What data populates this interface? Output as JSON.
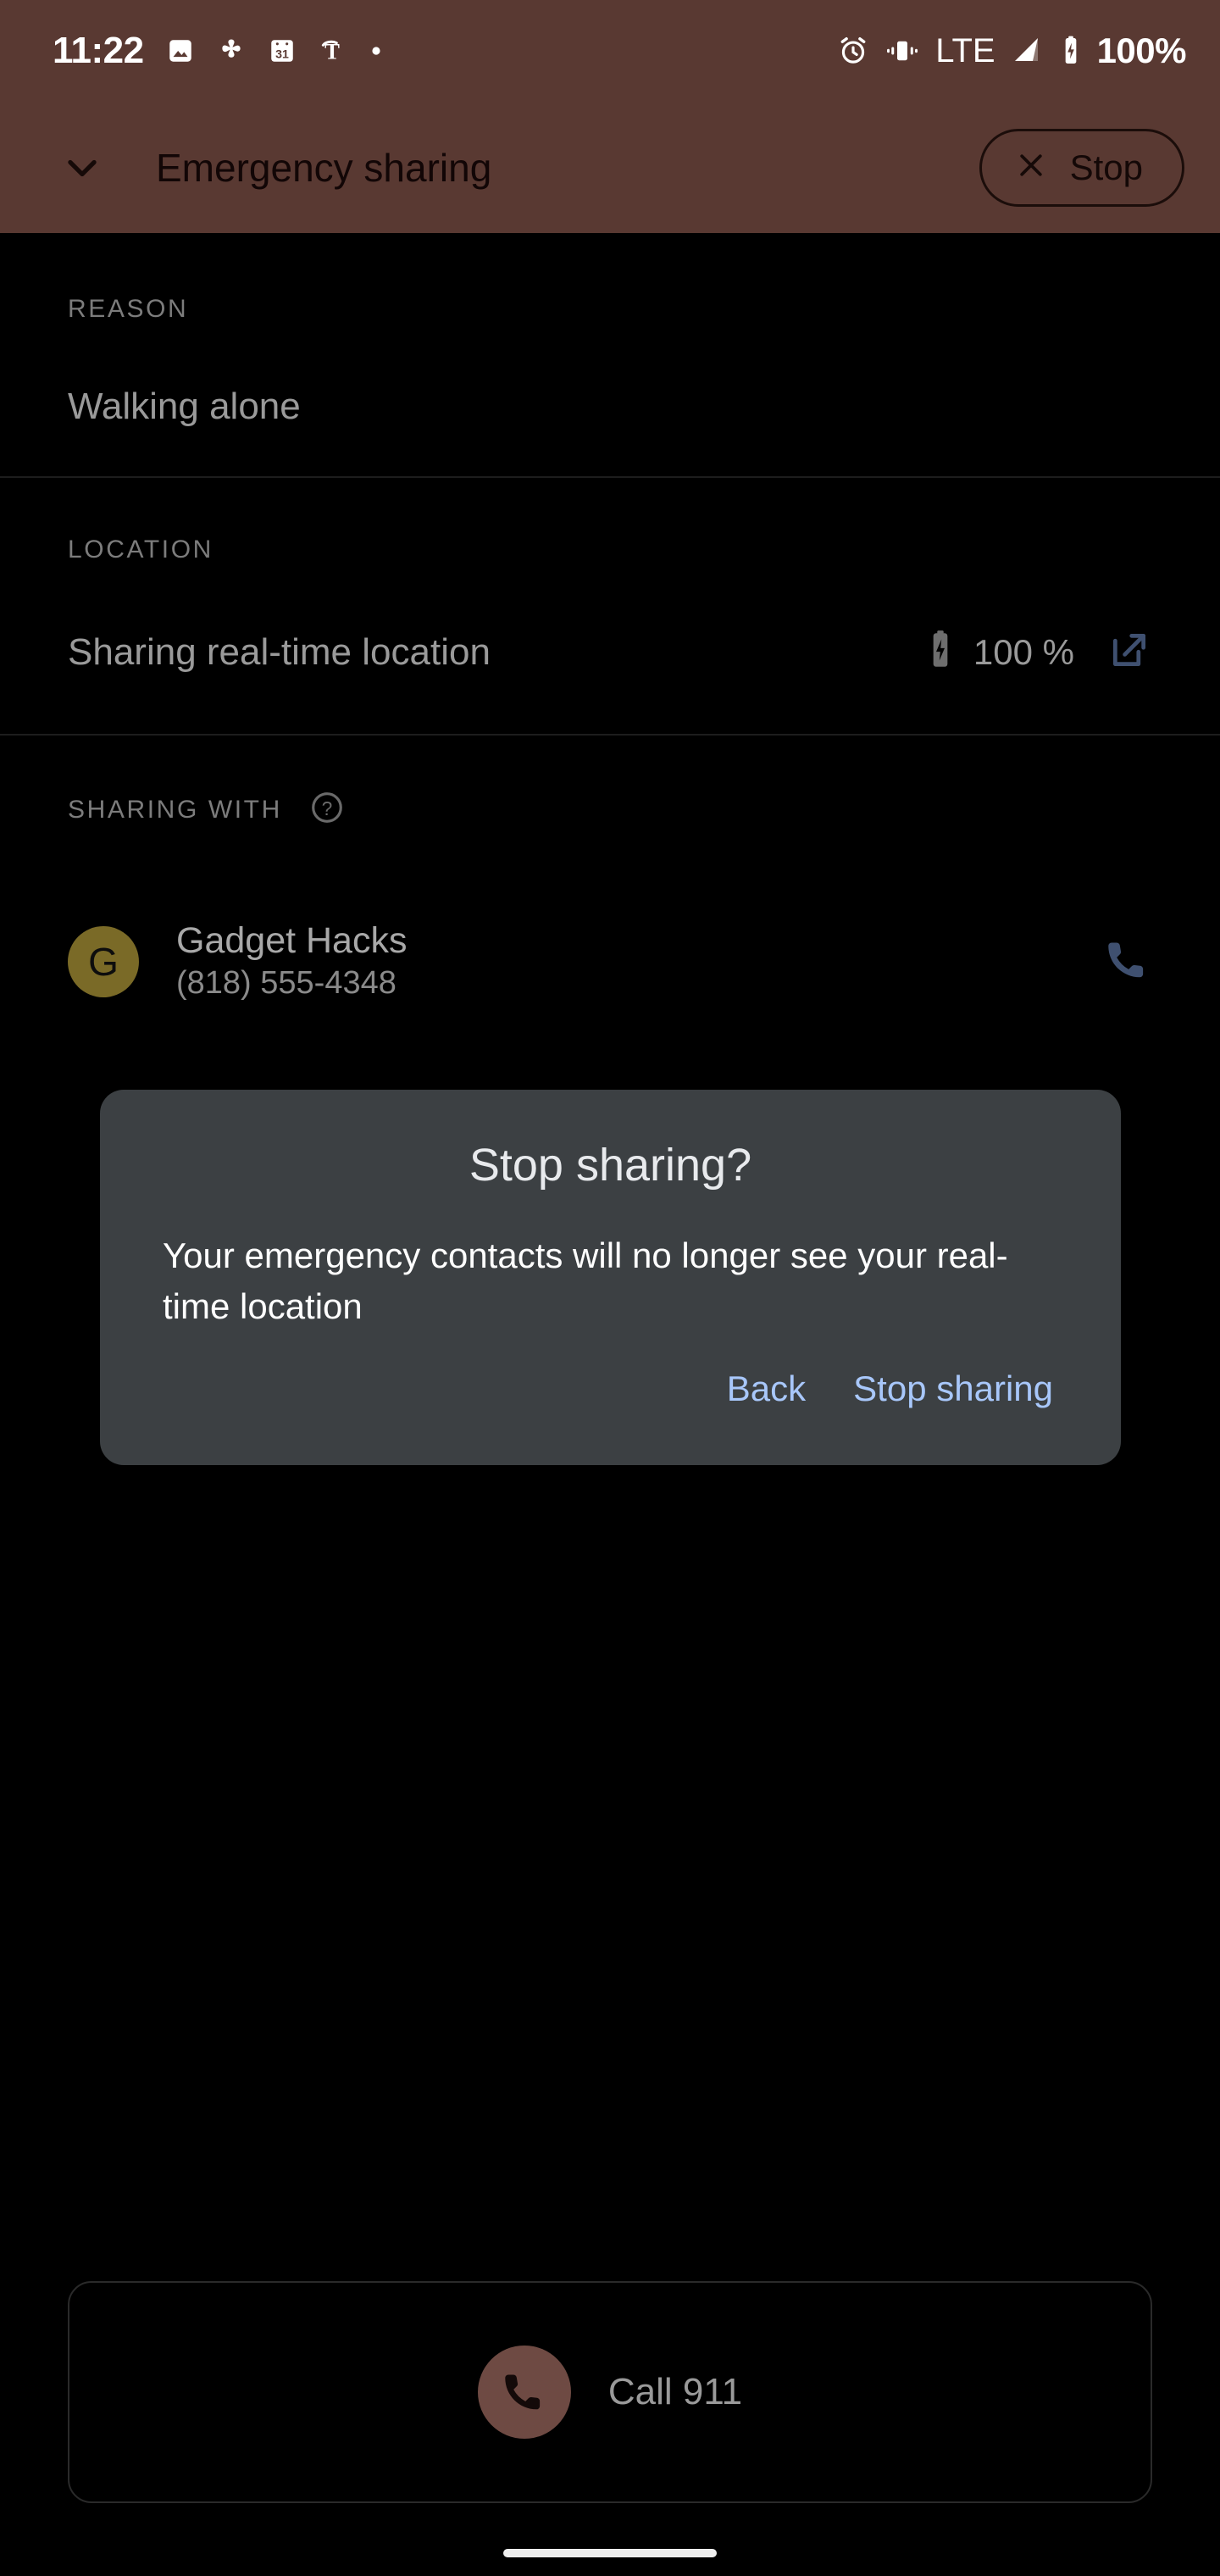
{
  "status_bar": {
    "time": "11:22",
    "battery_percent": "100%",
    "left_icons": [
      "photos-icon",
      "asterisk-icon",
      "calendar-31-icon",
      "nytimes-icon",
      "dot-icon"
    ],
    "right_icons": [
      "alarm-icon",
      "vibrate-icon",
      "lte-label",
      "signal-bars-icon",
      "battery-charging-icon"
    ],
    "network_label": "LTE",
    "background_color": "#593932"
  },
  "header": {
    "title": "Emergency sharing",
    "collapse_icon": "chevron-down-icon",
    "stop_button": {
      "label": "Stop",
      "icon": "close-icon"
    }
  },
  "sections": {
    "reason": {
      "label": "REASON",
      "value": "Walking alone"
    },
    "location": {
      "label": "LOCATION",
      "value": "Sharing real-time location",
      "battery_icon": "battery-charging-icon",
      "battery_value": "100 %",
      "open_icon": "open-in-new-icon"
    },
    "sharing_with": {
      "label": "SHARING WITH",
      "help_icon": "help-circle-icon",
      "contacts": [
        {
          "avatar_initial": "G",
          "avatar_color": "#7a6a27",
          "name": "Gadget Hacks",
          "phone": "(818) 555-4348",
          "call_icon": "phone-icon"
        }
      ]
    }
  },
  "dialog": {
    "title": "Stop sharing?",
    "body": "Your emergency contacts will no longer see your real-time location",
    "back_label": "Back",
    "confirm_label": "Stop sharing",
    "background_color": "#3c4043",
    "action_color": "#a8c7fa"
  },
  "call_911": {
    "label": "Call 911",
    "icon": "phone-icon",
    "icon_background": "#6e4a43"
  },
  "nav_bar": {
    "gesture_pill": "home-gesture-pill"
  }
}
